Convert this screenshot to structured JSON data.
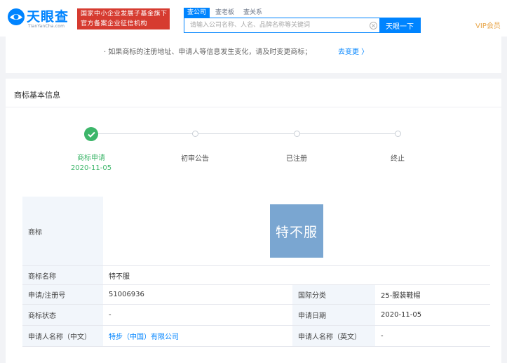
{
  "header": {
    "logo_cn": "天眼查",
    "logo_en": "TianYanCha.com",
    "badge_line1": "国家中小企业发展子基金旗下",
    "badge_line2": "官方备案企业征信机构",
    "search_tabs": [
      "查公司",
      "查老板",
      "查关系"
    ],
    "search_placeholder": "请输入公司名称、人名、品牌名称等关键词",
    "search_button": "天眼一下",
    "vip_label": "VIP会员"
  },
  "notice": {
    "text": "· 如果商标的注册地址、申请人等信息发生变化，请及时变更商标；",
    "link": "去变更 〉"
  },
  "main": {
    "section_title": "商标基本信息",
    "timeline": [
      {
        "label": "商标申请",
        "date": "2020-11-05",
        "done": true
      },
      {
        "label": "初审公告",
        "date": "",
        "done": false
      },
      {
        "label": "已注册",
        "date": "",
        "done": false
      },
      {
        "label": "终止",
        "date": "",
        "done": false
      }
    ],
    "table": {
      "trademark_label": "商标",
      "trademark_image_text": "特不服",
      "name_label": "商标名称",
      "name_value": "特不服",
      "reg_no_label": "申请/注册号",
      "reg_no_value": "51006936",
      "intl_class_label": "国际分类",
      "intl_class_value": "25-服装鞋帽",
      "status_label": "商标状态",
      "status_value": "-",
      "apply_date_label": "申请日期",
      "apply_date_value": "2020-11-05",
      "applicant_cn_label": "申请人名称（中文）",
      "applicant_cn_value": "特步（中国）有限公司",
      "applicant_en_label": "申请人名称（英文）",
      "applicant_en_value": "-"
    }
  },
  "colors": {
    "brand_blue": "#0084ff",
    "badge_red": "#d63b30",
    "success_green": "#3db66a",
    "vip_gold": "#e8a64a",
    "trademark_bg": "#7aa6d1"
  }
}
